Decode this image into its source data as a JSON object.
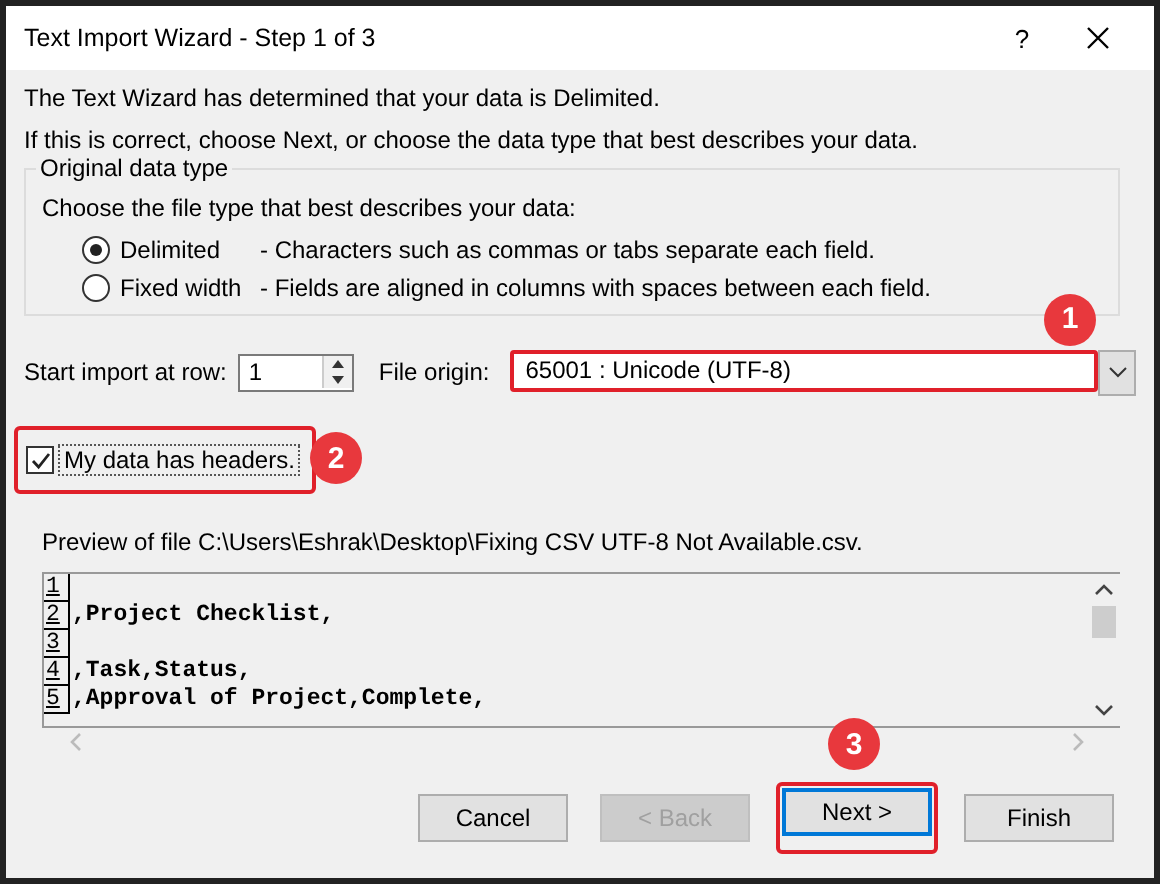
{
  "window": {
    "title": "Text Import Wizard - Step 1 of 3",
    "help": "?"
  },
  "intro": [
    "The Text Wizard has determined that your data is Delimited.",
    "If this is correct, choose Next, or choose the data type that best describes your data."
  ],
  "group": {
    "title": "Original data type",
    "prompt": "Choose the file type that best describes your data:",
    "options": [
      {
        "label": "Delimited",
        "description": "- Characters such as commas or tabs separate each field.",
        "selected": true
      },
      {
        "label": "Fixed width",
        "description": "- Fields are aligned in columns with spaces between each field.",
        "selected": false
      }
    ]
  },
  "start_row": {
    "label": "Start import at row:",
    "value": "1"
  },
  "file_origin": {
    "label": "File origin:",
    "value": "65001 : Unicode (UTF-8)",
    "callout": "1"
  },
  "headers_checkbox": {
    "label": "My data has headers.",
    "checked": true,
    "callout": "2"
  },
  "preview": {
    "label": "Preview of file C:\\Users\\Eshrak\\Desktop\\Fixing CSV UTF-8 Not Available.csv.",
    "lines": [
      {
        "number": "1"
      },
      {
        "number": "2",
        "text": ",Project Checklist,"
      },
      {
        "number": "3"
      },
      {
        "number": "4",
        "text": ",Task,Status,"
      },
      {
        "number": "5",
        "text": ",Approval of Project,Complete,"
      }
    ]
  },
  "buttons": [
    {
      "label": "Cancel",
      "disabled": false,
      "default": false
    },
    {
      "label": "< Back",
      "disabled": true,
      "default": false
    },
    {
      "label": "Next >",
      "disabled": false,
      "default": true,
      "callout": "3"
    },
    {
      "label": "Finish",
      "disabled": false,
      "default": false
    }
  ]
}
